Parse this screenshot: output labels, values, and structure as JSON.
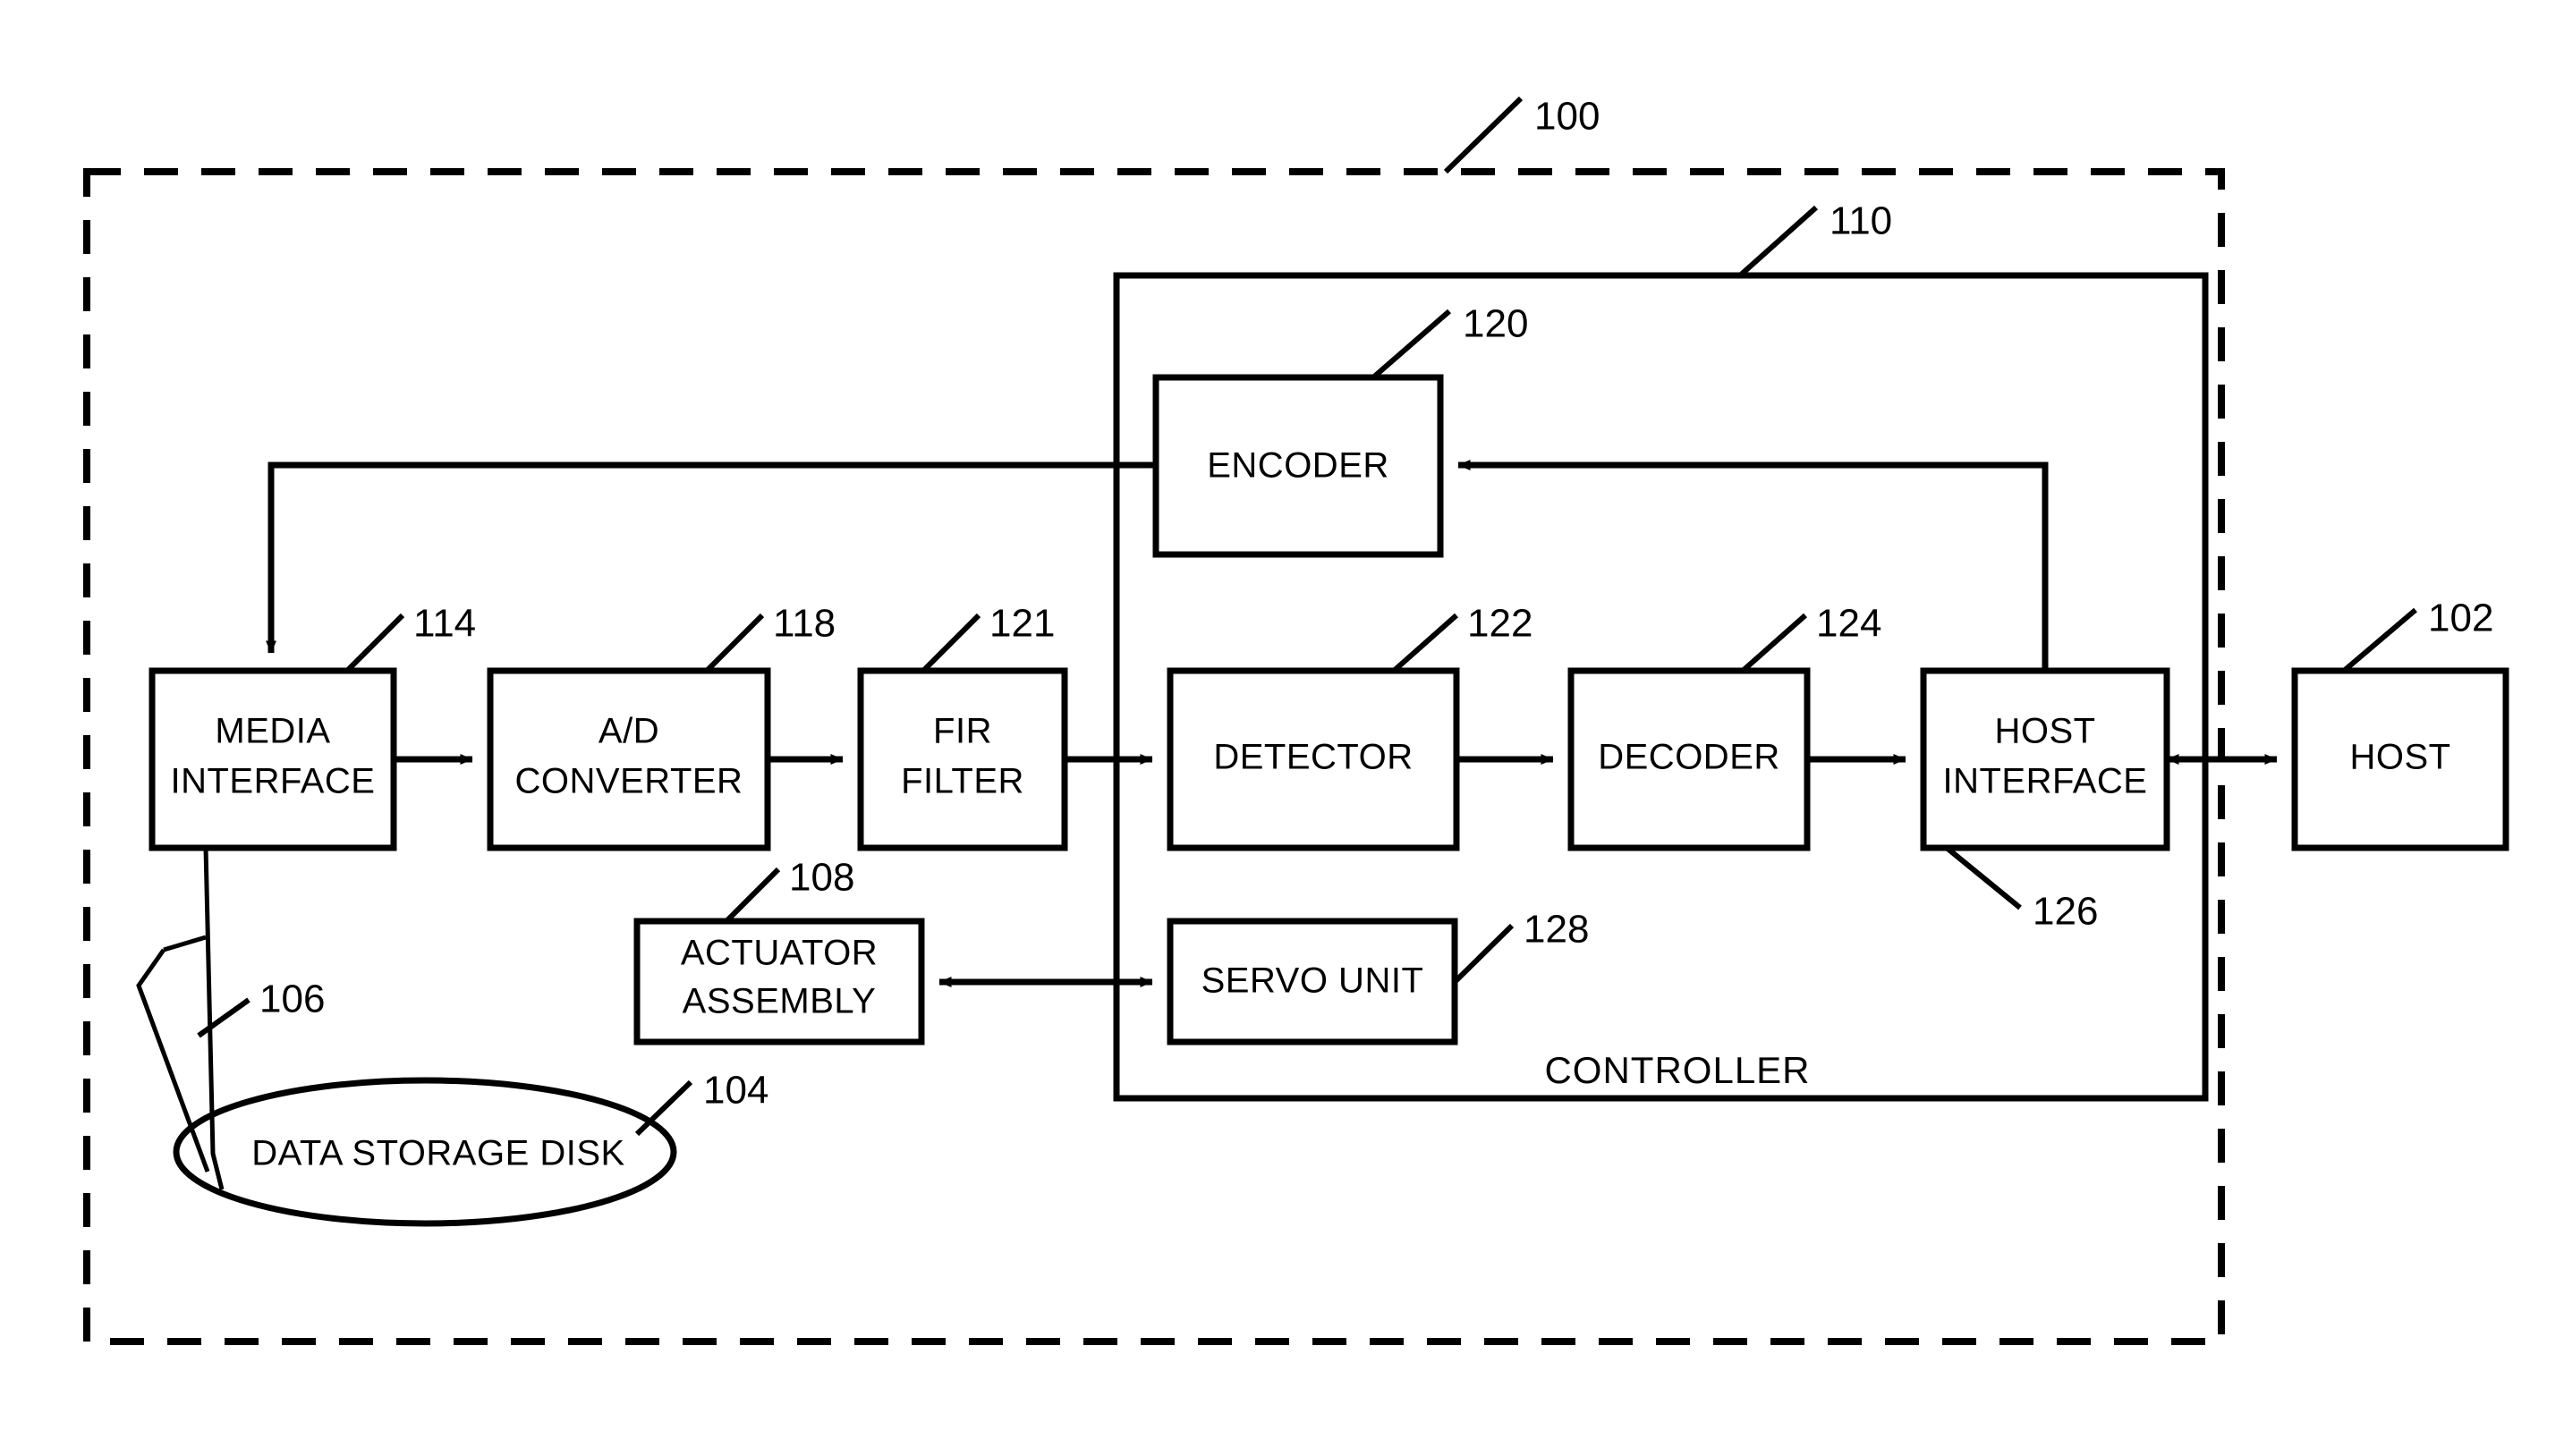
{
  "figure": {
    "type": "patent-block-diagram",
    "system_label": "CONTROLLER",
    "reference_numerals": {
      "system": "100",
      "host": "102",
      "disk": "104",
      "head": "106",
      "actuator": "108",
      "controller": "110",
      "media_interface": "114",
      "ad_converter": "118",
      "encoder": "120",
      "fir_filter": "121",
      "detector": "122",
      "decoder": "124",
      "host_interface": "126",
      "servo_unit": "128"
    },
    "blocks": [
      {
        "id": "media_interface",
        "label_line1": "MEDIA",
        "label_line2": "INTERFACE",
        "ref": "114"
      },
      {
        "id": "ad_converter",
        "label_line1": "A/D",
        "label_line2": "CONVERTER",
        "ref": "118"
      },
      {
        "id": "fir_filter",
        "label_line1": "FIR",
        "label_line2": "FILTER",
        "ref": "121"
      },
      {
        "id": "detector",
        "label_line1": "DETECTOR",
        "label_line2": "",
        "ref": "122"
      },
      {
        "id": "decoder",
        "label_line1": "DECODER",
        "label_line2": "",
        "ref": "124"
      },
      {
        "id": "host_interface",
        "label_line1": "HOST",
        "label_line2": "INTERFACE",
        "ref": "126"
      },
      {
        "id": "host",
        "label_line1": "HOST",
        "label_line2": "",
        "ref": "102"
      },
      {
        "id": "encoder",
        "label_line1": "ENCODER",
        "label_line2": "",
        "ref": "120"
      },
      {
        "id": "servo_unit",
        "label_line1": "SERVO UNIT",
        "label_line2": "",
        "ref": "128"
      },
      {
        "id": "actuator_assembly",
        "label_line1": "ACTUATOR",
        "label_line2": "ASSEMBLY",
        "ref": "108"
      },
      {
        "id": "data_storage_disk",
        "label_line1": "DATA STORAGE DISK",
        "label_line2": "",
        "ref": "104"
      }
    ],
    "labels": {
      "media_interface_l1": "MEDIA",
      "media_interface_l2": "INTERFACE",
      "ad_converter_l1": "A/D",
      "ad_converter_l2": "CONVERTER",
      "fir_filter_l1": "FIR",
      "fir_filter_l2": "FILTER",
      "detector": "DETECTOR",
      "decoder": "DECODER",
      "host_interface_l1": "HOST",
      "host_interface_l2": "INTERFACE",
      "host": "HOST",
      "encoder": "ENCODER",
      "servo_unit": "SERVO UNIT",
      "actuator_l1": "ACTUATOR",
      "actuator_l2": "ASSEMBLY",
      "disk": "DATA STORAGE DISK",
      "controller": "CONTROLLER"
    },
    "colors": {
      "stroke": "#000000",
      "fill": "#ffffff",
      "background": "#ffffff"
    }
  }
}
